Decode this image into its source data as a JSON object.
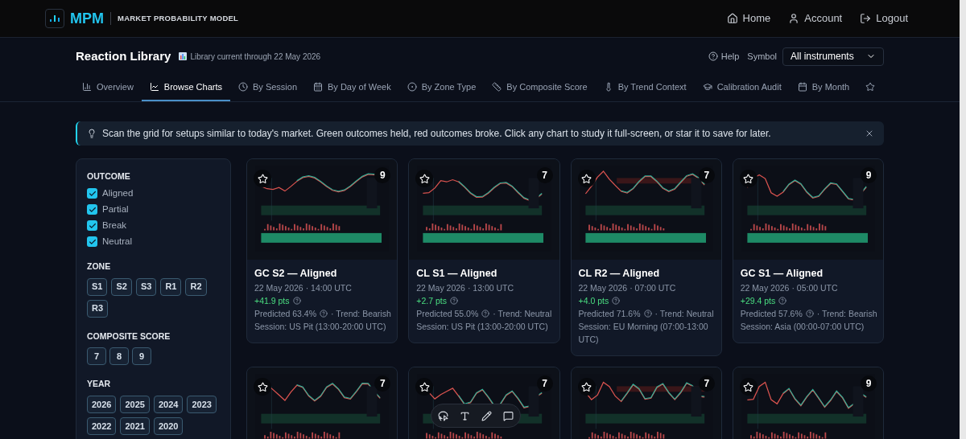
{
  "brand": {
    "name": "MPM",
    "tagline": "MARKET PROBABILITY MODEL"
  },
  "top_nav": [
    "Home",
    "Account",
    "Logout"
  ],
  "page": {
    "title": "Reaction Library",
    "status": "Library current through 22 May 2026"
  },
  "help": "Help",
  "symbol": {
    "label": "Symbol",
    "value": "All instruments"
  },
  "tabs": [
    {
      "label": "Overview",
      "selected": false
    },
    {
      "label": "Browse Charts",
      "selected": true
    },
    {
      "label": "By Session",
      "selected": false
    },
    {
      "label": "By Day of Week",
      "selected": false
    },
    {
      "label": "By Zone Type",
      "selected": false
    },
    {
      "label": "By Composite Score",
      "selected": false
    },
    {
      "label": "By Trend Context",
      "selected": false
    },
    {
      "label": "Calibration Audit",
      "selected": false
    },
    {
      "label": "By Month",
      "selected": false
    },
    {
      "selected": false
    }
  ],
  "banner": "Scan the grid for setups similar to today's market. Green outcomes held, red outcomes broke. Click any chart to study it full-screen, or star it to save for later.",
  "filters": {
    "outcome": {
      "title": "OUTCOME",
      "items": [
        {
          "label": "Aligned",
          "checked": true
        },
        {
          "label": "Partial",
          "checked": true
        },
        {
          "label": "Break",
          "checked": true
        },
        {
          "label": "Neutral",
          "checked": true
        }
      ]
    },
    "zone": {
      "title": "ZONE",
      "chips": [
        {
          "label": "S1",
          "selected": false
        },
        {
          "label": "S2",
          "selected": false
        },
        {
          "label": "S3",
          "selected": false
        },
        {
          "label": "R1",
          "selected": false
        },
        {
          "label": "R2",
          "selected": false
        },
        {
          "label": "R3",
          "selected": false
        }
      ]
    },
    "score": {
      "title": "COMPOSITE SCORE",
      "chips": [
        {
          "label": "7",
          "selected": false
        },
        {
          "label": "8",
          "selected": false
        },
        {
          "label": "9",
          "selected": false
        }
      ]
    },
    "year": {
      "title": "YEAR",
      "chips": [
        {
          "label": "2026",
          "selected": false
        },
        {
          "label": "2025",
          "selected": false
        },
        {
          "label": "2024",
          "selected": false
        },
        {
          "label": "2023",
          "selected": false
        },
        {
          "label": "2022",
          "selected": false
        },
        {
          "label": "2021",
          "selected": false
        },
        {
          "label": "2020",
          "selected": false
        }
      ]
    }
  },
  "cards": [
    {
      "score": "9",
      "starred": false,
      "title": "GC S2 — Aligned",
      "time": "22 May 2026 · 14:00 UTC",
      "pts": "+41.9 pts",
      "predicted": "Predicted 63.4%",
      "trend": "· Trend: Bearish",
      "session": "Session: US Pit (13:00-20:00 UTC)"
    },
    {
      "score": "7",
      "starred": false,
      "title": "CL S1 — Aligned",
      "time": "22 May 2026 · 13:00 UTC",
      "pts": "+2.7 pts",
      "predicted": "Predicted 55.0%",
      "trend": "· Trend: Neutral",
      "session": "Session: US Pit (13:00-20:00 UTC)"
    },
    {
      "score": "7",
      "starred": false,
      "title": "CL R2 — Aligned",
      "time": "22 May 2026 · 07:00 UTC",
      "pts": "+4.0 pts",
      "predicted": "Predicted 71.6%",
      "trend": "· Trend: Neutral",
      "session": "Session: EU Morning (07:00-13:00 UTC)"
    },
    {
      "score": "9",
      "starred": false,
      "title": "GC S1 — Aligned",
      "time": "22 May 2026 · 05:00 UTC",
      "pts": "+29.4 pts",
      "predicted": "Predicted 57.6%",
      "trend": "· Trend: Bearish",
      "session": "Session: Asia (00:00-07:00 UTC)"
    },
    {
      "score": "7",
      "starred": false
    },
    {
      "score": "7",
      "starred": false
    },
    {
      "score": "7",
      "starred": false
    },
    {
      "score": "9",
      "starred": false
    }
  ]
}
